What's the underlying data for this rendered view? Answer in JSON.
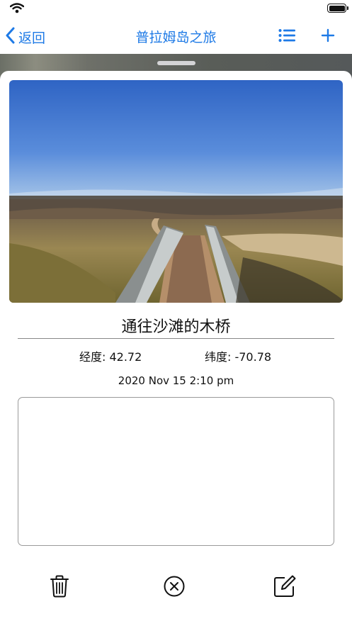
{
  "nav": {
    "back_label": "返回",
    "title": "普拉姆岛之旅"
  },
  "photo": {
    "subject": "wooden boardwalk to beach"
  },
  "entry": {
    "title": "通往沙滩的木桥",
    "latitude": "经度: 42.72",
    "longitude": "纬度: -70.78",
    "date": "2020 Nov 15 2:10 pm",
    "notes": ""
  },
  "icons": {
    "back": "chevron-left-icon",
    "list": "list-icon",
    "add": "plus-icon",
    "delete": "trash-icon",
    "cancel": "x-circle-icon",
    "edit": "square-pencil-icon"
  },
  "colors": {
    "accent": "#1e7ae6"
  }
}
